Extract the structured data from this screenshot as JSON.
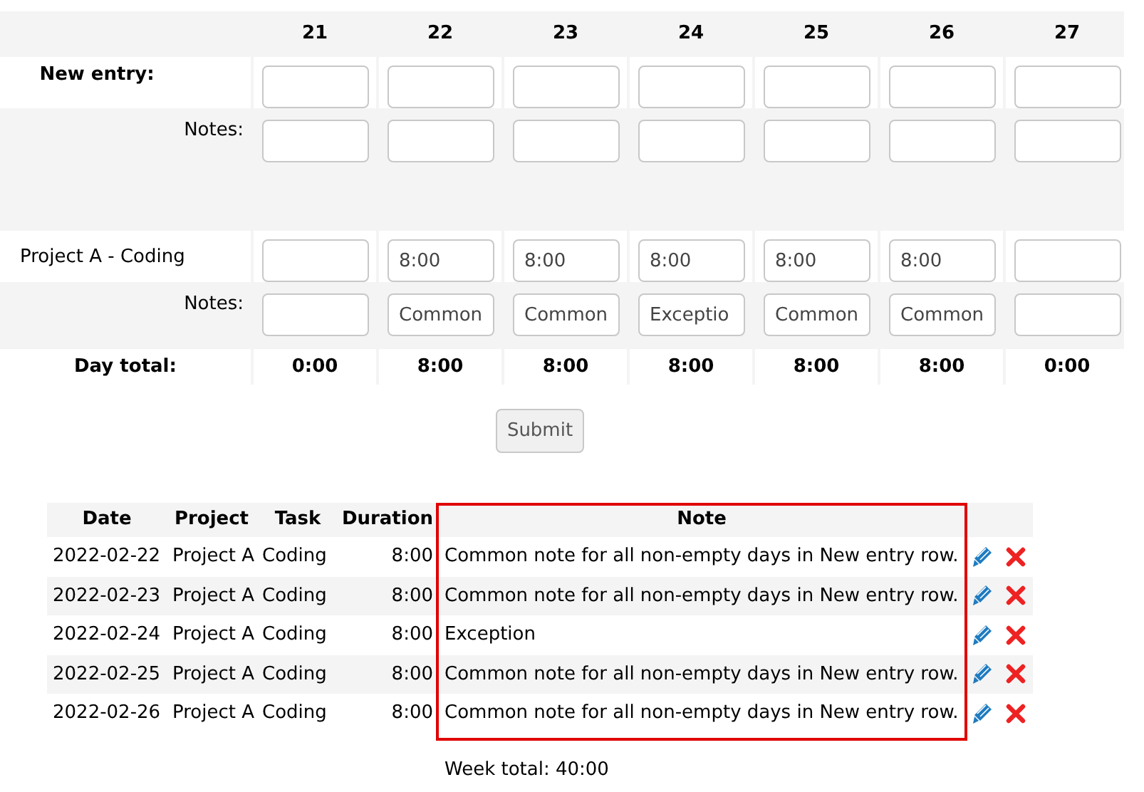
{
  "week_grid": {
    "days": [
      "21",
      "22",
      "23",
      "24",
      "25",
      "26",
      "27"
    ],
    "new_entry": {
      "label": "New entry:",
      "hours": [
        {
          "filled": false
        },
        {
          "filled": false
        },
        {
          "filled": false
        },
        {
          "filled": false
        },
        {
          "filled": false
        },
        {
          "filled": false
        },
        {
          "filled": false
        }
      ],
      "notes_label": "Notes:",
      "notes": [
        {
          "filled": false
        },
        {
          "filled": false
        },
        {
          "filled": false
        },
        {
          "filled": false
        },
        {
          "filled": false
        },
        {
          "filled": false
        },
        {
          "filled": false
        }
      ]
    },
    "entries": [
      {
        "label": "Project A - Coding",
        "hours": [
          {
            "filled": false
          },
          {
            "filled": true,
            "value": "8:00"
          },
          {
            "filled": true,
            "value": "8:00"
          },
          {
            "filled": true,
            "value": "8:00"
          },
          {
            "filled": true,
            "value": "8:00"
          },
          {
            "filled": true,
            "value": "8:00"
          },
          {
            "filled": false
          }
        ],
        "notes_label": "Notes:",
        "notes": [
          {
            "filled": false
          },
          {
            "filled": true,
            "value": "Common"
          },
          {
            "filled": true,
            "value": "Common"
          },
          {
            "filled": true,
            "value": "Exceptio"
          },
          {
            "filled": true,
            "value": "Common"
          },
          {
            "filled": true,
            "value": "Common"
          },
          {
            "filled": false
          }
        ]
      }
    ],
    "day_total": {
      "label": "Day total:",
      "values": [
        "0:00",
        "8:00",
        "8:00",
        "8:00",
        "8:00",
        "8:00",
        "0:00"
      ]
    }
  },
  "submit_button": "Submit",
  "entry_table": {
    "columns": [
      "Date",
      "Project",
      "Task",
      "Duration",
      "Note"
    ],
    "rows": [
      {
        "date": "2022-02-22",
        "project": "Project A",
        "task": "Coding",
        "duration": "8:00",
        "note": "Common note for all non-empty days in New entry row."
      },
      {
        "date": "2022-02-23",
        "project": "Project A",
        "task": "Coding",
        "duration": "8:00",
        "note": "Common note for all non-empty days in New entry row."
      },
      {
        "date": "2022-02-24",
        "project": "Project A",
        "task": "Coding",
        "duration": "8:00",
        "note": "Exception"
      },
      {
        "date": "2022-02-25",
        "project": "Project A",
        "task": "Coding",
        "duration": "8:00",
        "note": "Common note for all non-empty days in New entry row."
      },
      {
        "date": "2022-02-26",
        "project": "Project A",
        "task": "Coding",
        "duration": "8:00",
        "note": "Common note for all non-empty days in New entry row."
      }
    ],
    "week_total": "Week total: 40:00"
  }
}
